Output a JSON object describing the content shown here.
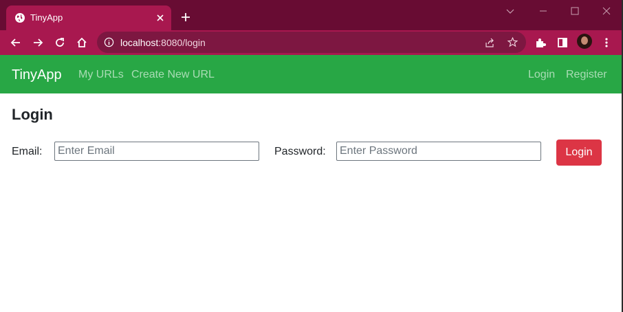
{
  "browser": {
    "tab_title": "TinyApp",
    "url_host": "localhost",
    "url_rest": ":8080/login",
    "colors": {
      "titlebar": "#680c33",
      "tab_active": "#a8184f",
      "omnibox": "#7d1741"
    }
  },
  "navbar": {
    "brand": "TinyApp",
    "links": [
      "My URLs",
      "Create New URL"
    ],
    "right_links": [
      "Login",
      "Register"
    ],
    "color": "#28a745"
  },
  "page": {
    "title": "Login",
    "email_label": "Email:",
    "email_placeholder": "Enter Email",
    "email_value": "",
    "password_label": "Password:",
    "password_placeholder": "Enter Password",
    "password_value": "",
    "submit_label": "Login",
    "submit_color": "#dc3545"
  }
}
